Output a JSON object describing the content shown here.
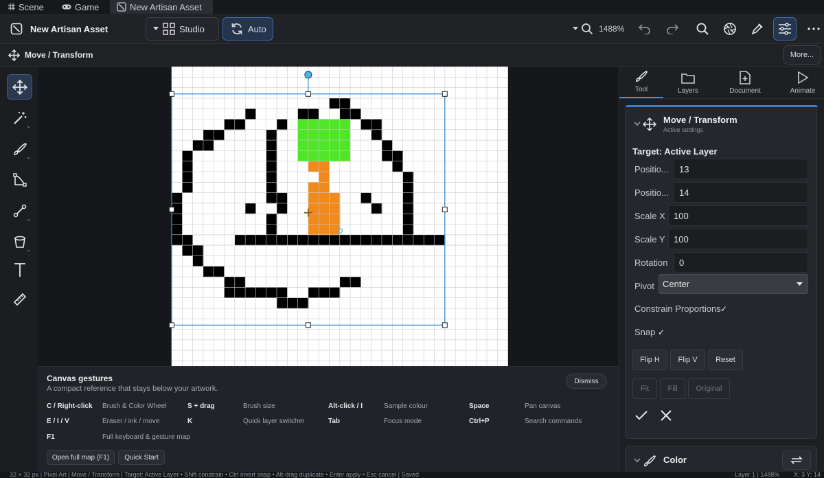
{
  "tabs": [
    {
      "label": "Scene",
      "icon": "grid-icon"
    },
    {
      "label": "Game",
      "icon": "gamepad-icon"
    },
    {
      "label": "New Artisan Asset",
      "icon": "artisan-icon"
    }
  ],
  "toolbar": {
    "title": "New Artisan Asset",
    "studio_label": "Studio",
    "auto_label": "Auto",
    "zoom": "1488%",
    "icons": [
      "undo-icon",
      "redo-icon",
      "search-icon",
      "aperture-icon",
      "eyedropper-icon",
      "sliders-icon",
      "more-icon"
    ]
  },
  "subbar": {
    "tool_name": "Move / Transform",
    "more_label": "More..."
  },
  "tools": [
    "move-icon",
    "magic-wand-icon",
    "brush-icon",
    "vector-icon",
    "line-icon",
    "bucket-icon",
    "text-icon",
    "ruler-icon"
  ],
  "canvas": {
    "grid_size": 32,
    "colors": {
      "black": "#000000",
      "green": "#4ee626",
      "orange": "#f08a1c",
      "handle": "#3a8ed0"
    },
    "pixels": {
      "black": [
        [
          15,
          1
        ],
        [
          16,
          1
        ],
        [
          7,
          2
        ],
        [
          12,
          2
        ],
        [
          13,
          2
        ],
        [
          16,
          2
        ],
        [
          17,
          2
        ],
        [
          6,
          3
        ],
        [
          5,
          3
        ],
        [
          10,
          3
        ],
        [
          18,
          3
        ],
        [
          19,
          3
        ],
        [
          3,
          4
        ],
        [
          4,
          4
        ],
        [
          9,
          4
        ],
        [
          19,
          4
        ],
        [
          2,
          5
        ],
        [
          3,
          5
        ],
        [
          9,
          5
        ],
        [
          20,
          5
        ],
        [
          1,
          6
        ],
        [
          9,
          6
        ],
        [
          20,
          6
        ],
        [
          21,
          6
        ],
        [
          1,
          7
        ],
        [
          9,
          7
        ],
        [
          21,
          7
        ],
        [
          1,
          8
        ],
        [
          9,
          8
        ],
        [
          22,
          8
        ],
        [
          1,
          9
        ],
        [
          9,
          9
        ],
        [
          22,
          9
        ],
        [
          0,
          10
        ],
        [
          9,
          10
        ],
        [
          10,
          10
        ],
        [
          18,
          10
        ],
        [
          22,
          10
        ],
        [
          0,
          11
        ],
        [
          7,
          11
        ],
        [
          10,
          11
        ],
        [
          19,
          11
        ],
        [
          22,
          11
        ],
        [
          0,
          12
        ],
        [
          9,
          12
        ],
        [
          22,
          12
        ],
        [
          0,
          13
        ],
        [
          9,
          13
        ],
        [
          22,
          13
        ],
        [
          0,
          14
        ],
        [
          1,
          14
        ],
        [
          6,
          14
        ],
        [
          7,
          14
        ],
        [
          8,
          14
        ],
        [
          9,
          14
        ],
        [
          10,
          14
        ],
        [
          11,
          14
        ],
        [
          12,
          14
        ],
        [
          13,
          14
        ],
        [
          14,
          14
        ],
        [
          15,
          14
        ],
        [
          16,
          14
        ],
        [
          17,
          14
        ],
        [
          18,
          14
        ],
        [
          19,
          14
        ],
        [
          20,
          14
        ],
        [
          21,
          14
        ],
        [
          22,
          14
        ],
        [
          23,
          14
        ],
        [
          24,
          14
        ],
        [
          25,
          14
        ],
        [
          1,
          15
        ],
        [
          2,
          15
        ],
        [
          2,
          16
        ],
        [
          3,
          17
        ],
        [
          4,
          17
        ],
        [
          5,
          18
        ],
        [
          6,
          18
        ],
        [
          16,
          18
        ],
        [
          17,
          18
        ],
        [
          5,
          19
        ],
        [
          6,
          19
        ],
        [
          7,
          19
        ],
        [
          8,
          19
        ],
        [
          9,
          19
        ],
        [
          10,
          19
        ],
        [
          13,
          19
        ],
        [
          14,
          19
        ],
        [
          15,
          19
        ],
        [
          10,
          20
        ],
        [
          11,
          20
        ],
        [
          12,
          20
        ]
      ],
      "green": [
        [
          12,
          3
        ],
        [
          13,
          3
        ],
        [
          14,
          3
        ],
        [
          15,
          3
        ],
        [
          16,
          3
        ],
        [
          12,
          4
        ],
        [
          13,
          4
        ],
        [
          14,
          4
        ],
        [
          15,
          4
        ],
        [
          16,
          4
        ],
        [
          12,
          5
        ],
        [
          13,
          5
        ],
        [
          14,
          5
        ],
        [
          15,
          5
        ],
        [
          16,
          5
        ],
        [
          12,
          6
        ],
        [
          13,
          6
        ],
        [
          14,
          6
        ],
        [
          15,
          6
        ],
        [
          16,
          6
        ]
      ],
      "orange": [
        [
          13,
          7
        ],
        [
          14,
          7
        ],
        [
          14,
          8
        ],
        [
          13,
          9
        ],
        [
          14,
          9
        ],
        [
          13,
          10
        ],
        [
          14,
          10
        ],
        [
          15,
          10
        ],
        [
          13,
          11
        ],
        [
          14,
          11
        ],
        [
          15,
          11
        ],
        [
          13,
          12
        ],
        [
          14,
          12
        ],
        [
          15,
          12
        ],
        [
          13,
          13
        ],
        [
          14,
          13
        ],
        [
          15,
          13
        ]
      ]
    }
  },
  "gestures": {
    "title": "Canvas gestures",
    "subtitle": "A compact reference that stays below your artwork.",
    "dismiss_label": "Dismiss",
    "shortcuts": [
      {
        "key": "C / Right-click",
        "desc": "Brush & Color Wheel"
      },
      {
        "key": "S + drag",
        "desc": "Brush size"
      },
      {
        "key": "Alt-click / I",
        "desc": "Sample colour"
      },
      {
        "key": "Space",
        "desc": "Pan canvas"
      },
      {
        "key": "E / I / V",
        "desc": "Eraser / ink / move"
      },
      {
        "key": "K",
        "desc": "Quick layer switcher"
      },
      {
        "key": "Tab",
        "desc": "Focus mode"
      },
      {
        "key": "Ctrl+P",
        "desc": "Search commands"
      },
      {
        "key": "F1",
        "desc": "Full keyboard & gesture map"
      }
    ],
    "open_map_label": "Open full map (F1)",
    "quick_start_label": "Quick Start"
  },
  "right_panel": {
    "tabs": [
      {
        "label": "Tool",
        "icon": "brush-icon"
      },
      {
        "label": "Layers",
        "icon": "folder-icon"
      },
      {
        "label": "Document",
        "icon": "document-icon"
      },
      {
        "label": "Animate",
        "icon": "play-icon"
      }
    ],
    "card_title": "Move / Transform",
    "card_subtitle": "Active settings",
    "target_label": "Target: Active Layer",
    "fields": [
      {
        "label": "Positio...",
        "value": "13"
      },
      {
        "label": "Positio...",
        "value": "14"
      },
      {
        "label": "Scale X",
        "value": "100"
      },
      {
        "label": "Scale Y",
        "value": "100"
      },
      {
        "label": "Rotation",
        "value": "0"
      }
    ],
    "pivot_label": "Pivot",
    "pivot_value": "Center",
    "constrain_label": "Constrain Proportions",
    "snap_label": "Snap",
    "flip_h": "Flip H",
    "flip_v": "Flip V",
    "reset": "Reset",
    "fit": "Fit",
    "fill": "Fill",
    "original": "Original",
    "color_title": "Color",
    "accent": "#4a8fd8"
  },
  "status": {
    "left": "32 × 32 px  |  Pixel Art  |  Move / Transform  |  Target: Active Layer  •  Shift constrain  •  Ctrl invert snap  •  Alt-drag duplicate  •  Enter apply  •  Esc cancel  |  Saved",
    "right": "Layer 1  |  1488%",
    "coords": "X: 3  Y: 14"
  }
}
